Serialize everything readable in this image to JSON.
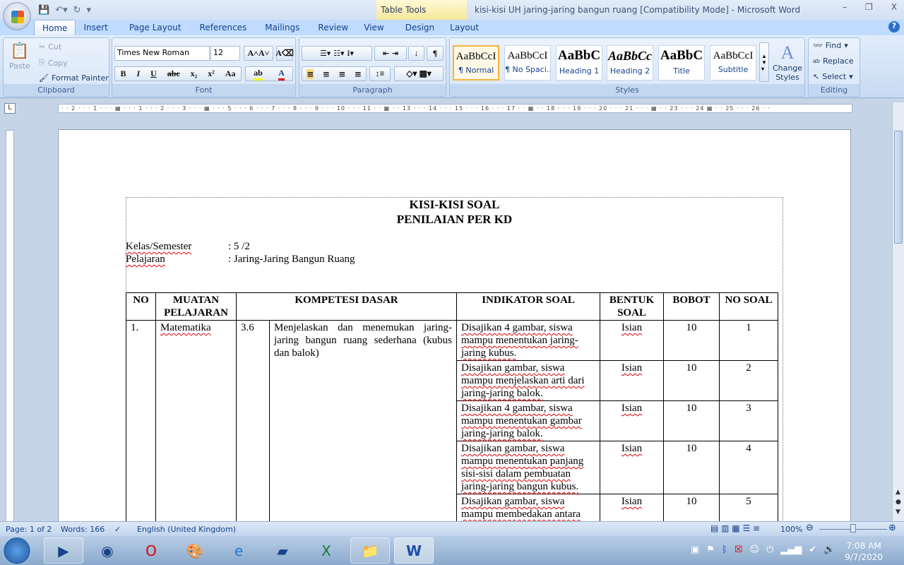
{
  "window": {
    "title": "kisi-kisi UH jaring-jaring bangun ruang [Compatibility Mode] - Microsoft Word",
    "context_tab_group": "Table Tools",
    "controls": [
      "–",
      "❐",
      "X"
    ]
  },
  "tabs": [
    "Home",
    "Insert",
    "Page Layout",
    "References",
    "Mailings",
    "Review",
    "View",
    "Design",
    "Layout"
  ],
  "ribbon": {
    "clipboard": {
      "label": "Clipboard",
      "paste": "Paste",
      "cut": "Cut",
      "copy": "Copy",
      "format_painter": "Format Painter"
    },
    "font": {
      "label": "Font",
      "font_name": "Times New Roman",
      "font_size": "12"
    },
    "paragraph": {
      "label": "Paragraph"
    },
    "styles": {
      "label": "Styles",
      "items": [
        {
          "sample": "AaBbCcI",
          "name": "¶ Normal"
        },
        {
          "sample": "AaBbCcI",
          "name": "¶ No Spaci..."
        },
        {
          "sample": "AaBbC",
          "name": "Heading 1"
        },
        {
          "sample": "AaBbCc",
          "name": "Heading 2"
        },
        {
          "sample": "AaBbC",
          "name": "Title"
        },
        {
          "sample": "AaBbCcI",
          "name": "Subtitle"
        }
      ],
      "change_styles": "Change Styles"
    },
    "editing": {
      "label": "Editing",
      "find": "Find",
      "replace": "Replace",
      "select": "Select"
    }
  },
  "ruler": "· · 2 · · · 1 · · · ▦ · · · 1 · · · 2 · · · 3 · · · ▦ · · · 5 · · · 6 · · · 7 · · · 8 · · · 9 · · · 10 · · · 11 · · ▦ · · 13 · · · 14 · · · 15 · · · 16 · · · 17 · · ▦ · · 18 · · · 19 · · · 20 · · · 21 · · · ▦ · · 23 · · · 24 ▦ · · 25 · · · 26 · ·",
  "document": {
    "title1": "KISI-KISI SOAL",
    "title2": "PENILAIAN PER KD",
    "meta": [
      {
        "label": "Kelas/Semester",
        "value": ": 5 /2"
      },
      {
        "label": "Pelajaran",
        "value": ": Jaring-Jaring  Bangun Ruang"
      }
    ],
    "table": {
      "headers": [
        "NO",
        "MUATAN PELAJARAN",
        "KOMPETESI DASAR",
        "INDIKATOR SOAL",
        "BENTUK SOAL",
        "BOBOT",
        "NO SOAL"
      ],
      "no": "1.",
      "muatan": "Matematika",
      "kd_no": "3.6",
      "kd_text": "Menjelaskan dan menemukan jaring-jaring bangun ruang sederhana (kubus dan balok)",
      "rows": [
        {
          "indikator": "Disajikan 4 gambar, siswa mampu menentukan jaring-jaring kubus.",
          "bentuk": "Isian",
          "bobot": "10",
          "no_soal": "1"
        },
        {
          "indikator": "Disajikan gambar, siswa mampu menjelaskan arti dari jaring-jaring  balok.",
          "bentuk": "Isian",
          "bobot": "10",
          "no_soal": "2"
        },
        {
          "indikator": "Disajikan 4 gambar, siswa mampu menentukan gambar jaring-jaring  balok.",
          "bentuk": "Isian",
          "bobot": "10",
          "no_soal": "3"
        },
        {
          "indikator": "Disajikan gambar, siswa mampu menentukan panjang sisi-sisi  dalam pembuatan jaring-jaring  bangun kubus.",
          "bentuk": "Isian",
          "bobot": "10",
          "no_soal": "4"
        },
        {
          "indikator": "Disajikan gambar, siswa mampu membedakan antara jaring-jaring kubus dan",
          "bentuk": "Isian",
          "bobot": "10",
          "no_soal": "5"
        }
      ]
    }
  },
  "status": {
    "page": "Page: 1 of 2",
    "words": "Words: 166",
    "language": "English (United Kingdom)",
    "zoom": "100%"
  },
  "clock": {
    "time": "7:08 AM",
    "date": "9/7/2020"
  }
}
